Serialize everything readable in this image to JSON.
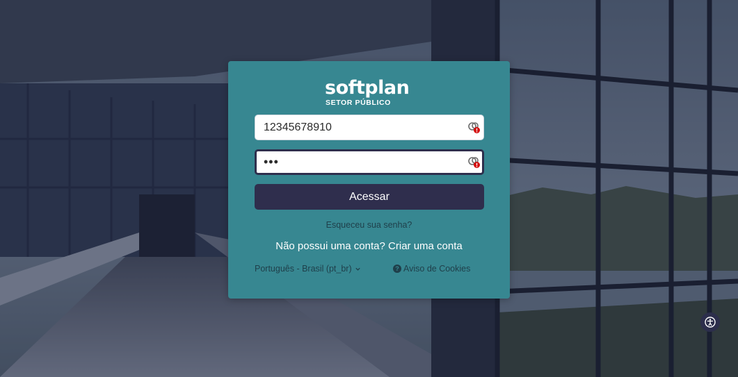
{
  "brand": {
    "logo_text": "softplan",
    "logo_subtitle": "SETOR PÚBLICO"
  },
  "login": {
    "username_value": "12345678910",
    "password_value": "•••",
    "submit_label": "Acessar",
    "forgot_password": "Esqueceu sua senha?",
    "signup_prompt": "Não possui uma conta?",
    "signup_link": "Criar uma conta"
  },
  "footer": {
    "language_label": "Português - Brasil (pt_br)",
    "cookies_label": "Aviso de Cookies",
    "cookies_icon_glyph": "?"
  },
  "icons": {
    "password_manager": "password-manager-icon",
    "accessibility": "accessibility-icon",
    "language_dropdown": "chevron-down-icon"
  },
  "colors": {
    "card": "#378791",
    "button": "#2f2e4d",
    "link_dark": "#1f3f4a"
  }
}
